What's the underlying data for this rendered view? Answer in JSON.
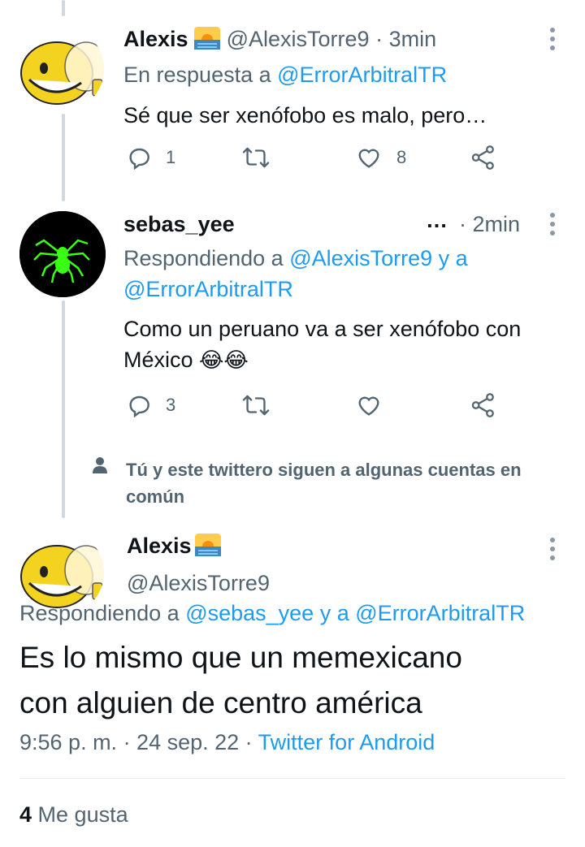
{
  "tweet1": {
    "display_name": "Alexis",
    "handle": "@AlexisTorre9",
    "time": "· 3min",
    "reply_prefix": "En respuesta a",
    "reply_mention": "@ErrorArbitralTR",
    "text": "Sé que ser xenófobo es malo, pero…",
    "replies": "1",
    "likes": "8"
  },
  "tweet2": {
    "display_name": "sebas_yee",
    "ellipsis": "…",
    "time": "· 2min",
    "reply_prefix": "Respondiendo a",
    "reply_mention1": "@AlexisTorre9",
    "reply_connector": "y a",
    "reply_mention2": "@ErrorArbitralTR",
    "text_line1": "Como un peruano va a ser xenófobo con",
    "text_line2": "México",
    "emoji": "😂😂",
    "replies": "3"
  },
  "mutual": {
    "text_line1": "Tú y este twittero siguen a algunas cuentas en",
    "text_line2": "común"
  },
  "main_tweet": {
    "display_name": "Alexis",
    "handle": "@AlexisTorre9",
    "reply_prefix": "Respondiendo a",
    "reply_mention1": "@sebas_yee",
    "reply_connector": "y a",
    "reply_mention2": "@ErrorArbitralTR",
    "text_line1": "Es lo mismo que un memexicano",
    "text_line2": "con alguien de centro américa",
    "timestamp": "9:56 p. m. · 24 sep. 22 ·",
    "client": "Twitter for Android",
    "likes_count": "4",
    "likes_label": "Me gusta"
  },
  "colors": {
    "accent": "#1d9bf0",
    "text": "#0f1419",
    "secondary": "#536471",
    "line": "#cfd9de"
  },
  "icons": [
    "reply-icon",
    "retweet-icon",
    "like-icon",
    "share-icon",
    "more-icon",
    "person-icon",
    "sunrise-emoji"
  ]
}
